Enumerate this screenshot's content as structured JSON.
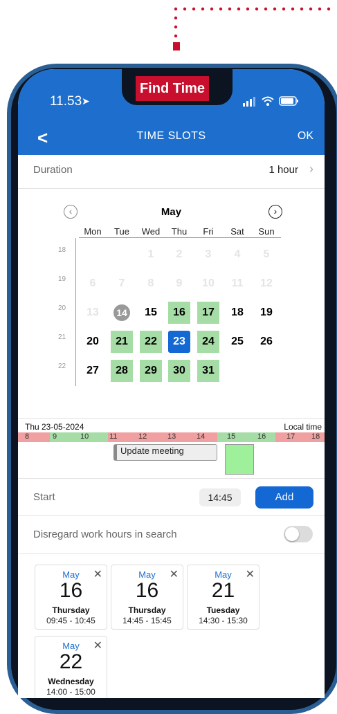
{
  "status_bar": {
    "time": "11.53"
  },
  "label": {
    "find_time": "Find Time"
  },
  "nav": {
    "back": "<",
    "title": "TIME SLOTS",
    "ok": "OK"
  },
  "duration": {
    "label": "Duration",
    "value": "1 hour"
  },
  "calendar": {
    "month": "May",
    "day_headers": [
      "Mon",
      "Tue",
      "Wed",
      "Thu",
      "Fri",
      "Sat",
      "Sun"
    ],
    "week_numbers": [
      "18",
      "19",
      "20",
      "21",
      "22"
    ],
    "weeks": [
      [
        "",
        "",
        "1",
        "2",
        "3",
        "4",
        "5"
      ],
      [
        "6",
        "7",
        "8",
        "9",
        "10",
        "11",
        "12"
      ],
      [
        "13",
        "14",
        "15",
        "16",
        "17",
        "18",
        "19"
      ],
      [
        "20",
        "21",
        "22",
        "23",
        "24",
        "25",
        "26"
      ],
      [
        "27",
        "28",
        "29",
        "30",
        "31",
        "",
        ""
      ]
    ]
  },
  "timeline": {
    "date": "Thu 23-05-2024",
    "local_time": "Local time",
    "hours": [
      "8",
      "9",
      "10",
      "11",
      "12",
      "13",
      "14",
      "15",
      "16",
      "17",
      "18"
    ],
    "event": "Update meeting"
  },
  "start": {
    "label": "Start",
    "time": "14:45",
    "add": "Add"
  },
  "disregard": {
    "label": "Disregard work hours in search"
  },
  "slots": [
    {
      "month": "May",
      "day": "16",
      "weekday": "Thursday",
      "time": "09:45 - 10:45"
    },
    {
      "month": "May",
      "day": "16",
      "weekday": "Thursday",
      "time": "14:45 - 15:45"
    },
    {
      "month": "May",
      "day": "21",
      "weekday": "Tuesday",
      "time": "14:30 - 15:30"
    },
    {
      "month": "May",
      "day": "22",
      "weekday": "Wednesday",
      "time": "14:00 - 15:00"
    }
  ],
  "colors": {
    "brand": "#1e6fcd",
    "accent_label": "#c8102e",
    "available": "#a6dca6",
    "busy": "#f0a0a0"
  }
}
